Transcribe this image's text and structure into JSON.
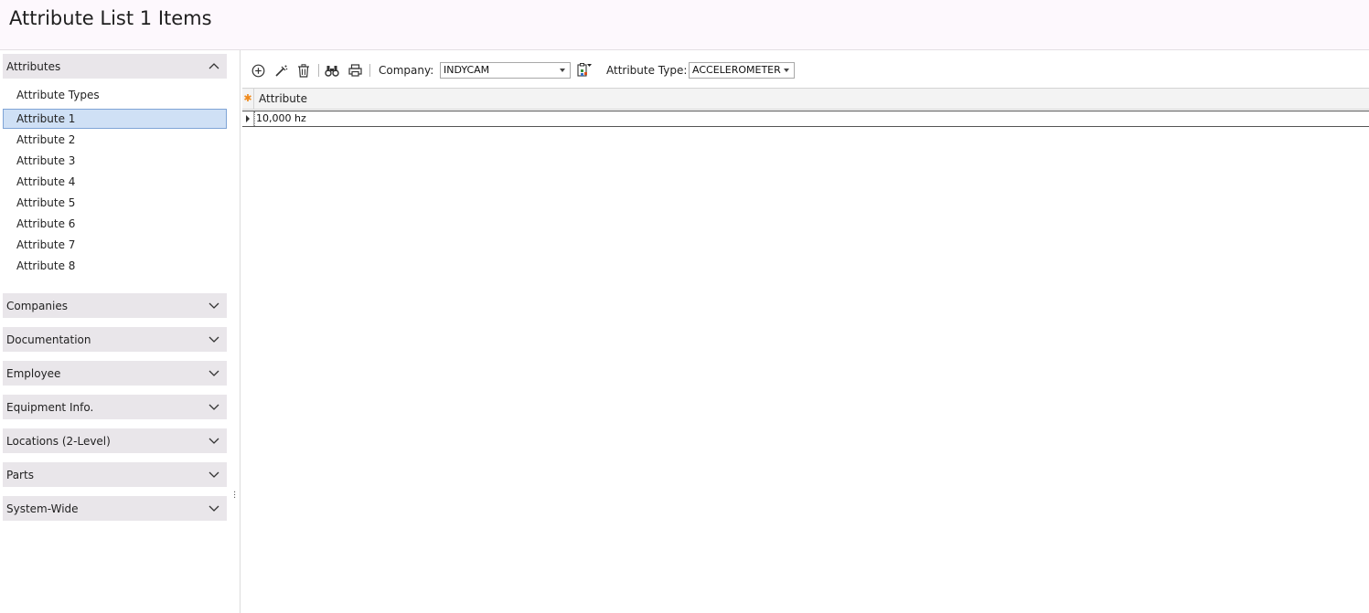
{
  "page": {
    "title": "Attribute List 1 Items"
  },
  "sidebar": {
    "attributes_group": {
      "label": "Attributes",
      "expanded": true,
      "items": [
        {
          "label": "Attribute Types",
          "selected": false
        },
        {
          "label": "Attribute 1",
          "selected": true
        },
        {
          "label": "Attribute 2",
          "selected": false
        },
        {
          "label": "Attribute 3",
          "selected": false
        },
        {
          "label": "Attribute 4",
          "selected": false
        },
        {
          "label": "Attribute 5",
          "selected": false
        },
        {
          "label": "Attribute 6",
          "selected": false
        },
        {
          "label": "Attribute 7",
          "selected": false
        },
        {
          "label": "Attribute 8",
          "selected": false
        }
      ]
    },
    "collapsed_groups": [
      {
        "label": "Companies"
      },
      {
        "label": "Documentation"
      },
      {
        "label": "Employee"
      },
      {
        "label": "Equipment Info."
      },
      {
        "label": "Locations (2-Level)"
      },
      {
        "label": "Parts"
      },
      {
        "label": "System-Wide"
      }
    ]
  },
  "toolbar": {
    "icons": [
      "add-icon",
      "edit-icon",
      "delete-icon",
      "find-icon",
      "print-icon",
      "copy-to-icon"
    ],
    "company_label": "Company:",
    "company_value": "INDYCAM",
    "attribute_type_label": "Attribute Type:",
    "attribute_type_value": "ACCELEROMETER"
  },
  "grid": {
    "columns": [
      "Attribute"
    ],
    "rows": [
      {
        "attribute": "10,000 hz"
      }
    ]
  },
  "colors": {
    "title_bar_bg": "#fdf8fd",
    "group_header_bg": "#e9e6ea",
    "selected_item_bg": "#cfe0f5",
    "selected_item_border": "#7fa4d6",
    "new_row_marker": "#f08a1c"
  }
}
